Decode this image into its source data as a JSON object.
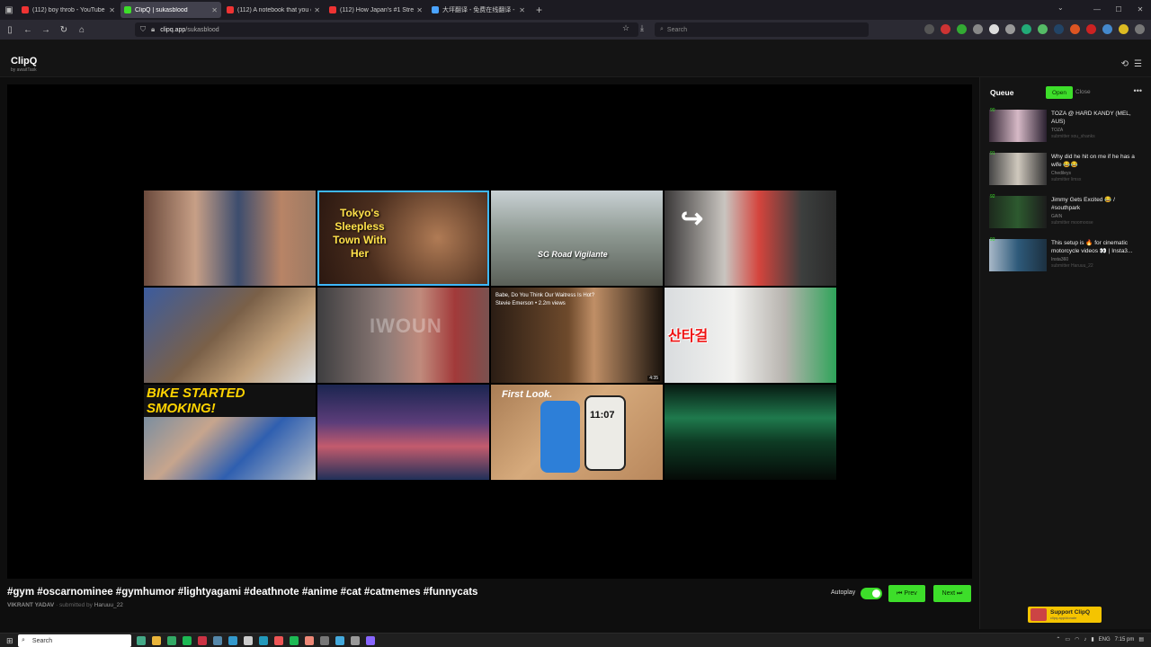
{
  "browser": {
    "tabs": [
      {
        "title": "(112) boy throb - YouTube",
        "color": "#e33"
      },
      {
        "title": "ClipQ | sukasblood",
        "color": "#3dde2a",
        "active": true
      },
      {
        "title": "(112) A notebook that you can ...",
        "color": "#e33"
      },
      {
        "title": "(112) How Japan's #1 Streamer ...",
        "color": "#e33"
      },
      {
        "title": "大坪翻译 - 免费在线翻译 - 挺塞帆",
        "color": "#4aa3ff"
      }
    ],
    "url_host": "clipq.app",
    "url_path": "/sukasblood",
    "search_placeholder": "Search"
  },
  "app": {
    "logo": "ClipQ",
    "logo_sub": "by awaitTask"
  },
  "grid_thumbs": [
    {
      "cap": ""
    },
    {
      "cap": "Tokyo's Sleepless Town With Her"
    },
    {
      "cap": "SG Road Vigilante"
    },
    {
      "cap": "↪"
    },
    {
      "cap": ""
    },
    {
      "cap": "IWOUN"
    },
    {
      "cap": "Babe, Do You Think Our Waitress Is Hot?",
      "sub": "Stevie Emerson • 2.2m views",
      "dur": "4:35"
    },
    {
      "cap": "산타걸"
    },
    {
      "cap": "BIKE STARTED SMOKING!"
    },
    {
      "cap": ""
    },
    {
      "cap": "First Look.",
      "clock": "11:07"
    },
    {
      "cap": ""
    }
  ],
  "video": {
    "title": "#gym #oscarnominee #gymhumor #lightyagami #deathnote #anime #cat #catmemes #funnycats",
    "author": "VIKRANT YADAV",
    "submitted_prefix": "· submitted by",
    "submitter": "Haruuu_22"
  },
  "controls": {
    "autoplay_label": "Autoplay",
    "autoplay_on": true,
    "prev_label": "⏮ Prev",
    "next_label": "Next ⏭"
  },
  "queue": {
    "title": "Queue",
    "open_label": "Open",
    "close_label": "Close",
    "items": [
      {
        "num": "90",
        "title": "TOZA @ HARD KANDY (MEL, AUS)",
        "author": "TOZA",
        "submitter": "submitter sou_shanks"
      },
      {
        "num": "91",
        "title": "Why did he hit on me if he has a wife 😂😂",
        "author": "Chedileys",
        "submitter": "submitter limsx"
      },
      {
        "num": "92",
        "title": "Jimmy Gets Excited 😂 / #southpark",
        "author": "GAIN",
        "submitter": "submitter moomoose"
      },
      {
        "num": "93",
        "title": "This setup is 🔥 for cinematic motorcycle videos 👀 | Insta3...",
        "author": "Insta360",
        "submitter": "submitter Haruuu_22"
      }
    ]
  },
  "support": {
    "label": "Support ClipQ",
    "sub": "clipq.app/donate"
  },
  "taskbar": {
    "search": "Search",
    "lang": "ENG",
    "time": "7:15 pm"
  }
}
